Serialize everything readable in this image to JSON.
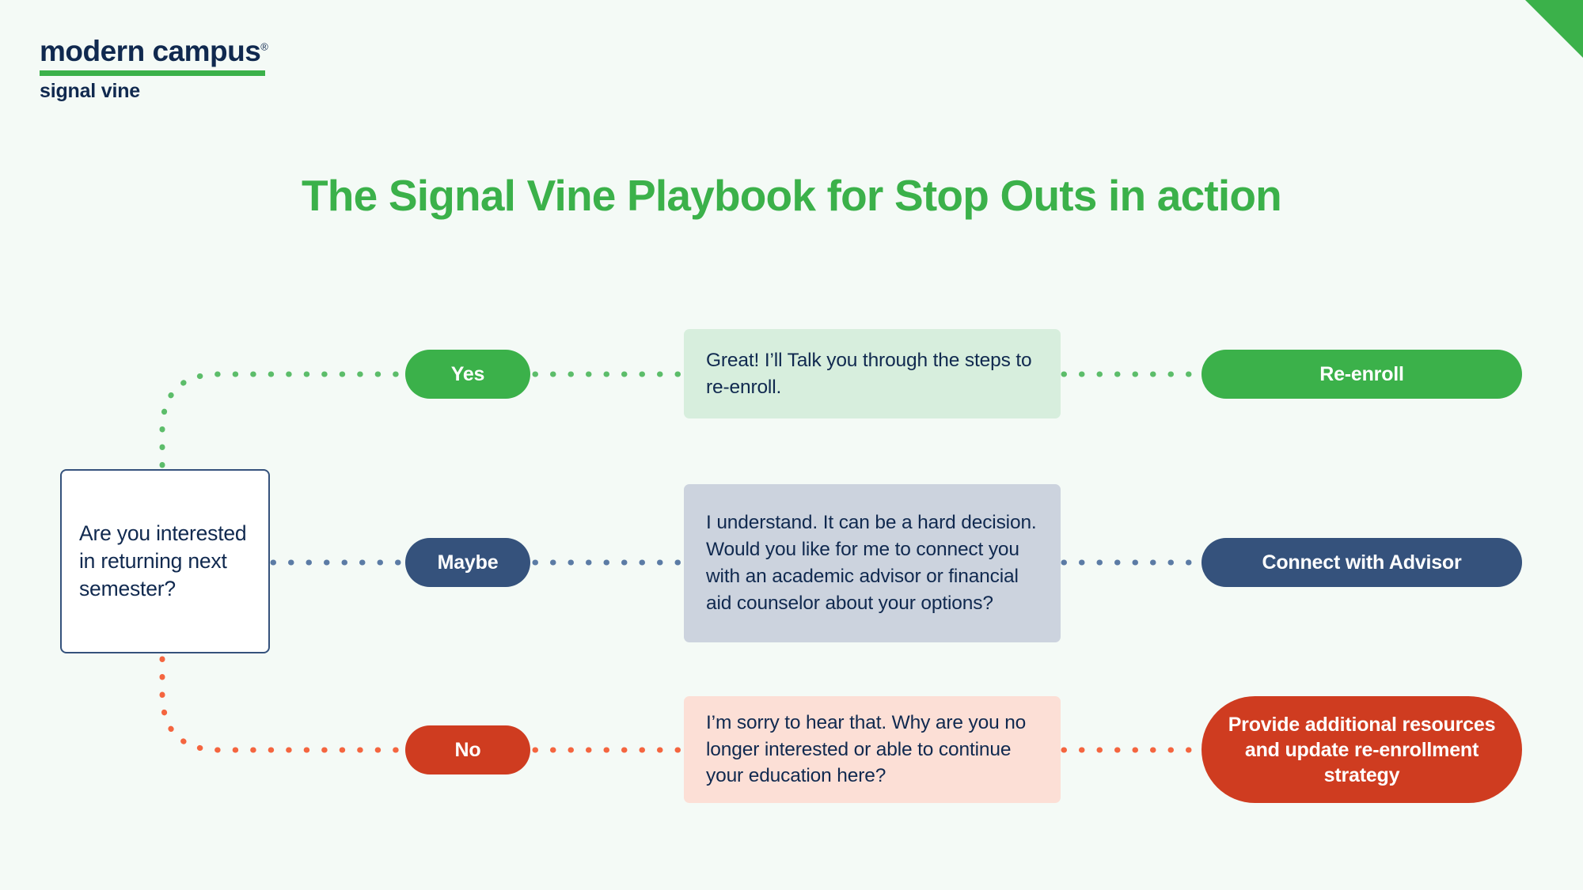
{
  "brand": {
    "logo_main": "modern campus",
    "logo_reg": "®",
    "logo_sub": "signal vine",
    "accent_green": "#3bb14a",
    "navy": "#10294f",
    "steel_blue": "#35527c",
    "red": "#cf3c20",
    "background": "#f4faf6"
  },
  "title": "The Signal Vine Playbook for Stop Outs in action",
  "flow": {
    "decision": {
      "text": "Are you interested in returning next semester?"
    },
    "branches": [
      {
        "id": "yes",
        "pill_label": "Yes",
        "pill_color": "#3bb14a",
        "message": "Great! I’ll Talk you through the steps to re-enroll.",
        "message_bg": "#d7eedd",
        "outcome_label": "Re-enroll",
        "outcome_color": "#3bb14a",
        "connector_color": "#3bb14a"
      },
      {
        "id": "maybe",
        "pill_label": "Maybe",
        "pill_color": "#35527c",
        "message": "I understand. It can be a hard decision. Would you like for me to connect you with an academic advisor or financial aid counselor about your options?",
        "message_bg": "#ccd3de",
        "outcome_label": "Connect with Advisor",
        "outcome_color": "#35527c",
        "connector_color": "#5b7ba5"
      },
      {
        "id": "no",
        "pill_label": "No",
        "pill_color": "#cf3c20",
        "message": "I’m sorry to hear that. Why are you no longer interested or able to continue your education here?",
        "message_bg": "#fcdfd6",
        "outcome_label": "Provide additional resources and update re-enrollment strategy",
        "outcome_color": "#cf3c20",
        "connector_color": "#f4653f"
      }
    ]
  },
  "decoration": {
    "corner_triangle_color": "#3bb14a"
  }
}
